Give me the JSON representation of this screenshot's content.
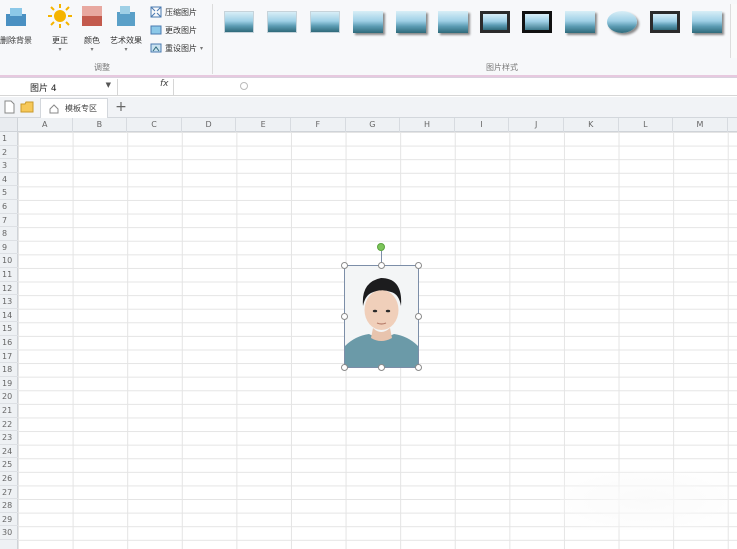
{
  "ribbon": {
    "adjust_group": {
      "label": "调整",
      "remove_bg": "删除背景",
      "correct": "更正",
      "color": "颜色",
      "art_effect": "艺术效果",
      "compress": "压缩图片",
      "change": "更改图片",
      "reset": "重设图片"
    },
    "styles_group": {
      "label": "图片样式"
    }
  },
  "formula_bar": {
    "name_box": "图片 4",
    "fx": "fx"
  },
  "tabs": {
    "doc_tab": "模板专区",
    "add": "+"
  },
  "columns": [
    "A",
    "B",
    "C",
    "D",
    "E",
    "F",
    "G",
    "H",
    "I",
    "J",
    "K",
    "L",
    "M"
  ],
  "rows": [
    "1",
    "2",
    "3",
    "4",
    "5",
    "6",
    "7",
    "8",
    "9",
    "10",
    "11",
    "12",
    "13",
    "14",
    "15",
    "16",
    "17",
    "18",
    "19",
    "20",
    "21",
    "22",
    "23",
    "24",
    "25",
    "26",
    "27",
    "28",
    "29",
    "30"
  ],
  "icons": {
    "new_doc": "new-document-icon",
    "folder": "folder-icon",
    "home": "home-icon"
  },
  "colors": {
    "accent": "#e7c9df",
    "rotation_handle": "#7cc55a"
  }
}
